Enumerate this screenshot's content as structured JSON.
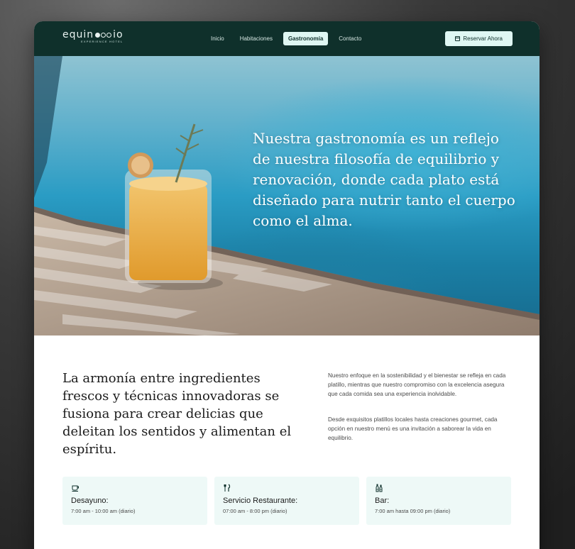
{
  "brand": {
    "logo_text_left": "equin",
    "logo_text_right": "io",
    "logo_subtitle": "EXPERIENCE HOTEL"
  },
  "nav": {
    "items": [
      {
        "label": "Inicio",
        "active": false
      },
      {
        "label": "Habitaciones",
        "active": false
      },
      {
        "label": "Gastronomía",
        "active": true
      },
      {
        "label": "Contacto",
        "active": false
      }
    ],
    "cta_label": "Reservar Ahora",
    "cta_icon": "calendar-icon"
  },
  "hero": {
    "text": "Nuestra gastronomía es un reflejo de nuestra filosofía de equilibrio y renovación, donde cada plato está diseñado para nutrir tanto el cuerpo como el alma."
  },
  "intro": {
    "heading": "La armonía entre ingredientes frescos y técnicas innovadoras se fusiona para crear delicias que deleitan los sentidos y alimentan el espíritu.",
    "paragraphs": [
      "Nuestro enfoque en la sostenibilidad y el bienestar se refleja en cada platillo, mientras que nuestro compromiso con la excelencia asegura que cada comida sea una experiencia inolvidable.",
      "Desde exquisitos platillos locales hasta creaciones gourmet, cada opción en nuestro menú es una invitación a saborear la vida en equilibrio."
    ]
  },
  "cards": [
    {
      "icon": "coffee-cup-icon",
      "title": "Desayuno:",
      "hours": "7:00 am - 10:00 am (diario)"
    },
    {
      "icon": "utensils-icon",
      "title": "Servicio Restaurante:",
      "hours": "07:00 am - 8:00 pm (diario)"
    },
    {
      "icon": "bottles-icon",
      "title": "Bar:",
      "hours": "7:00 am hasta 09:00 pm (diario)"
    }
  ],
  "colors": {
    "nav_bg": "#0f302b",
    "accent": "#dff7f3",
    "card_bg": "#eef9f7"
  }
}
